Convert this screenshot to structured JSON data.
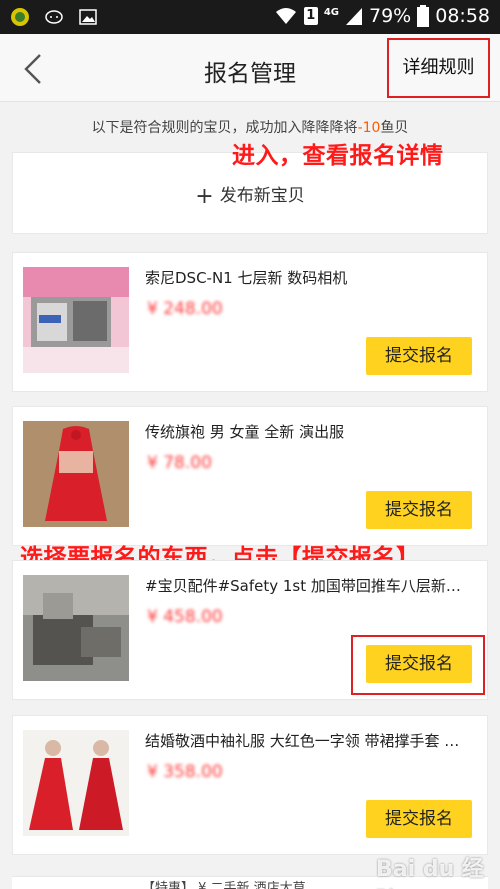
{
  "status_bar": {
    "sim_indicator": "1",
    "network": "4G",
    "battery": "79%",
    "time": "08:58"
  },
  "nav": {
    "back_label": "返回",
    "title": "报名管理",
    "rules_link": "详细规则"
  },
  "notice": {
    "prefix": "以下是符合规则的宝贝，成功加入降降降将",
    "highlight": "-10",
    "suffix": "鱼贝"
  },
  "annotations": {
    "enter": "进入，查看报名详情",
    "select": "选择要报名的东西，点击【提交报名】"
  },
  "publish": {
    "label": "发布新宝贝",
    "icon": "plus-icon"
  },
  "items": [
    {
      "title": "索尼DSC-N1 七层新 数码相机",
      "price": "¥ 248.00",
      "button": "提交报名"
    },
    {
      "title": "传统旗袍 男 女童 全新 演出服",
      "price": "¥ 78.00",
      "button": "提交报名"
    },
    {
      "title": "#宝贝配件#Safety 1st 加国带回推车八层新…",
      "price": "¥ 458.00",
      "button": "提交报名"
    },
    {
      "title": "结婚敬酒中袖礼服 大红色一字领 带裙撑手套 …",
      "price": "¥ 358.00",
      "button": "提交报名"
    }
  ],
  "partial_item": {
    "title": "【特惠】 ¥ 二手新 酒店大草…"
  },
  "watermark": "Bai du 经验",
  "colors": {
    "accent_yellow": "#ffd21f",
    "price_red": "#ff3b3b",
    "annotation_red": "#ff1a1a",
    "highlight_orange": "#ff5a00"
  }
}
